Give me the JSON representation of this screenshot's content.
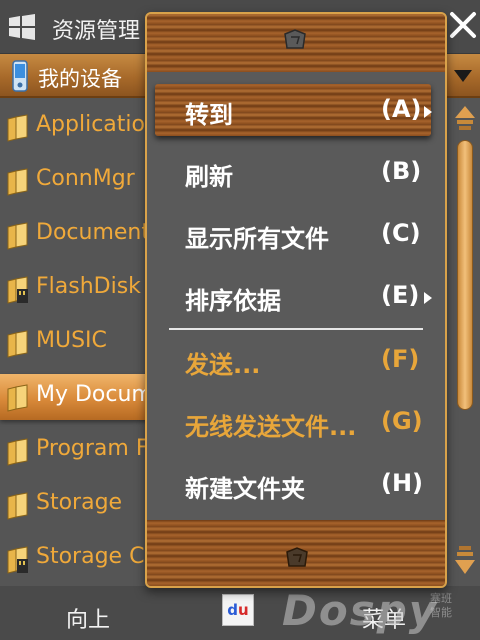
{
  "title_bar": {
    "title": "资源管理",
    "start_icon": "windows-flag-icon",
    "close_icon": "close-x-icon"
  },
  "location_bar": {
    "label": "我的设备",
    "icon": "device-icon"
  },
  "files": [
    {
      "name": "Application",
      "icon": "folder-icon"
    },
    {
      "name": "ConnMgr",
      "icon": "folder-icon"
    },
    {
      "name": "Documents",
      "icon": "folder-icon"
    },
    {
      "name": "FlashDisk",
      "icon": "storage-card-folder-icon"
    },
    {
      "name": "MUSIC",
      "icon": "folder-icon"
    },
    {
      "name": "My Docum",
      "icon": "folder-icon",
      "selected": true
    },
    {
      "name": "Program F",
      "icon": "folder-icon"
    },
    {
      "name": "Storage",
      "icon": "folder-icon"
    },
    {
      "name": "Storage Ca",
      "icon": "storage-card-folder-icon"
    }
  ],
  "context_menu": {
    "items": [
      {
        "label": "转到",
        "key": "(A)",
        "submenu": true,
        "active": true
      },
      {
        "label": "刷新",
        "key": "(B)"
      },
      {
        "label": "显示所有文件",
        "key": "(C)"
      },
      {
        "label": "排序依据",
        "key": "(E)",
        "submenu": true
      },
      {
        "label": "发送...",
        "key": "(F)",
        "disabled": true
      },
      {
        "label": "无线发送文件...",
        "key": "(G)",
        "disabled": true
      },
      {
        "label": "新建文件夹",
        "key": "(H)"
      }
    ]
  },
  "bottom_bar": {
    "left_soft_key": "向上",
    "right_soft_key": "菜单",
    "watermark": "Dospy",
    "watermark_sub": "塞班\n智能"
  },
  "colors": {
    "accent_orange": "#f0a93a",
    "wood": "#a8642c",
    "menu_bg": "#5a5a5a",
    "disabled_text": "#e8a63a"
  }
}
